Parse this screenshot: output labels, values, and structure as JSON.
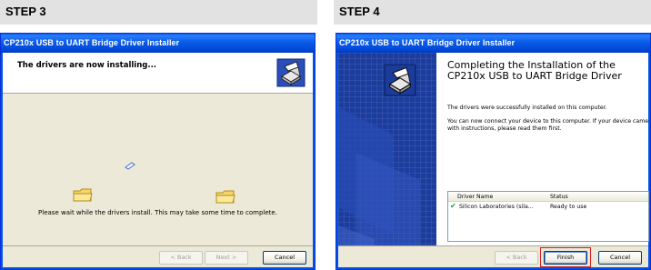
{
  "steps": {
    "left_label": "STEP 3",
    "right_label": "STEP 4"
  },
  "step3": {
    "window_title": "CP210x USB to UART Bridge Driver Installer",
    "heading": "The drivers are now installing...",
    "wait_message": "Please wait while the drivers install. This may take some time to complete.",
    "buttons": {
      "back": "< Back",
      "next": "Next >",
      "cancel": "Cancel"
    }
  },
  "step4": {
    "window_title": "CP210x USB to UART Bridge Driver Installer",
    "title": "Completing the Installation of the CP210x USB to UART Bridge Driver",
    "paragraph1": "The drivers were successfully installed on this computer.",
    "paragraph2": "You can now connect your device to this computer. If your device came with instructions, please read them first.",
    "list": {
      "col_name": "Driver Name",
      "col_status": "Status",
      "rows": [
        {
          "name": "Silicon Laboratories (sila...",
          "status": "Ready to use"
        }
      ]
    },
    "buttons": {
      "back": "< Back",
      "finish": "Finish",
      "cancel": "Cancel"
    }
  },
  "colors": {
    "titlebar": "#0054e3",
    "dialog_face": "#ece9d8",
    "highlight": "#d41d1d",
    "check": "#1d9a2e"
  }
}
